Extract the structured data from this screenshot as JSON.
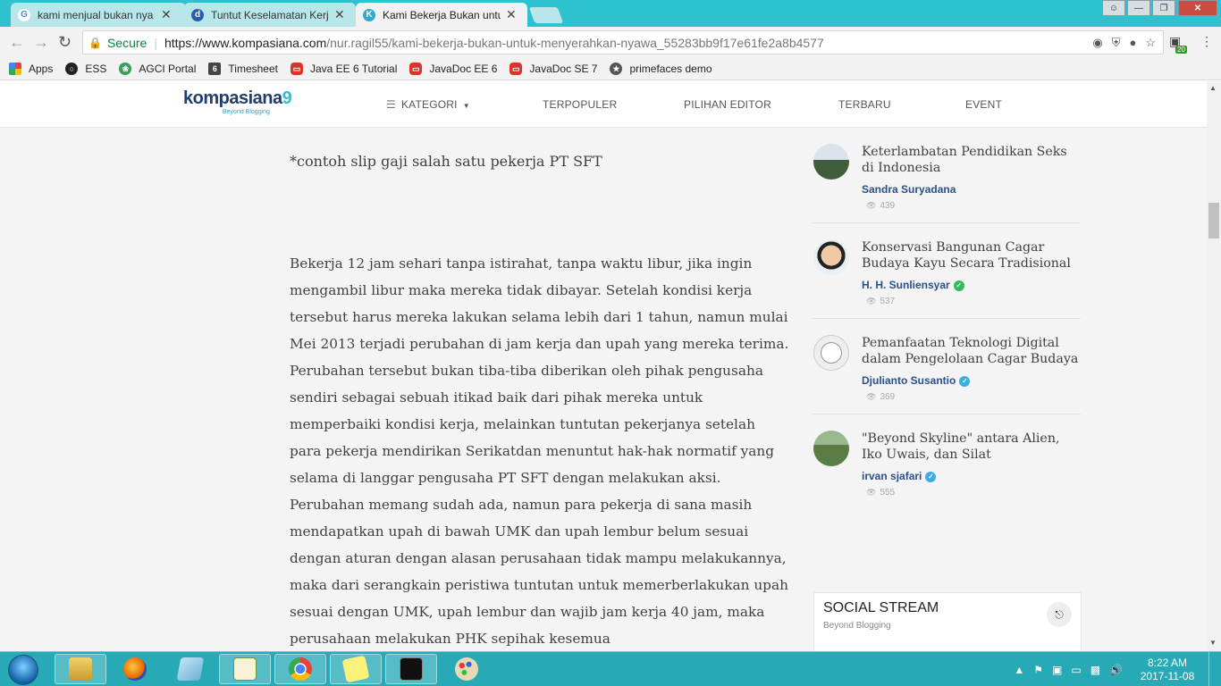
{
  "browser": {
    "tabs": [
      {
        "title": "kami menjual bukan nya",
        "icon": "google-icon",
        "active": false
      },
      {
        "title": "Tuntut Keselamatan Kerja",
        "icon": "site-d-icon",
        "active": false
      },
      {
        "title": "Kami Bekerja Bukan untu",
        "icon": "kompasiana-icon",
        "active": true
      }
    ],
    "close_glyph": "✕",
    "secure_label": "Secure",
    "url_host": "https://www.kompasiana.com",
    "url_path": "/nur.ragil55/kami-bekerja-bukan-untuk-menyerahkan-nyawa_55283bb9f17e61fe2a8b4577",
    "extension_badge": "20"
  },
  "bookmarks": [
    {
      "label": "Apps",
      "icon": "apps-grid-icon"
    },
    {
      "label": "ESS",
      "icon": "ess-icon"
    },
    {
      "label": "AGCI Portal",
      "icon": "agci-icon"
    },
    {
      "label": "Timesheet",
      "icon": "timesheet-icon"
    },
    {
      "label": "Java EE 6 Tutorial",
      "icon": "oracle-icon"
    },
    {
      "label": "JavaDoc EE 6",
      "icon": "oracle-icon"
    },
    {
      "label": "JavaDoc SE 7",
      "icon": "oracle-icon"
    },
    {
      "label": "primefaces demo",
      "icon": "primefaces-icon"
    }
  ],
  "site": {
    "logo_text": "kompasiana",
    "logo_nine": "9",
    "logo_tagline": "Beyond Blogging",
    "nav": {
      "kategori": "KATEGORI",
      "terpopuler": "TERPOPULER",
      "pilihan_editor": "PILIHAN EDITOR",
      "terbaru": "TERBARU",
      "event": "EVENT"
    }
  },
  "article": {
    "caption": "*contoh slip gaji salah satu pekerja PT SFT",
    "body": "Bekerja 12 jam sehari tanpa istirahat, tanpa waktu libur, jika ingin mengambil libur maka mereka tidak dibayar. Setelah kondisi kerja tersebut harus mereka lakukan selama lebih dari 1 tahun, namun mulai Mei 2013 terjadi perubahan di jam kerja dan upah yang mereka terima. Perubahan tersebut bukan tiba-tiba diberikan oleh pihak pengusaha sendiri sebagai sebuah itikad baik dari pihak mereka untuk memperbaiki kondisi kerja, melainkan tuntutan pekerjanya setelah para pekerja mendirikan Serikatdan menuntut hak-hak normatif yang selama di langgar pengusaha PT SFT dengan melakukan aksi. Perubahan memang sudah ada, namun para pekerja di sana masih mendapatkan upah di bawah UMK dan upah lembur belum sesuai dengan aturan dengan alasan perusahaan tidak mampu melakukannya, maka dari serangkain peristiwa tuntutan untuk memerberlakukan upah sesuai dengan UMK, upah lembur dan wajib jam kerja 40 jam, maka perusahaan melakukan PHK sepihak kesemua"
  },
  "sidebar": {
    "items": [
      {
        "title": "Keterlambatan Pendidikan Seks di Indonesia",
        "author": "Sandra Suryadana",
        "verified": false,
        "views": "439"
      },
      {
        "title": "Konservasi Bangunan Cagar Budaya Kayu Secara Tradisional",
        "author": "H. H. Sunliensyar",
        "verified": true,
        "verified_color": "#2ebd59",
        "views": "537"
      },
      {
        "title": "Pemanfaatan Teknologi Digital dalam Pengelolaan Cagar Budaya",
        "author": "Djulianto Susantio",
        "verified": true,
        "verified_color": "#3aaee0",
        "views": "369"
      },
      {
        "title": "\"Beyond Skyline\" antara Alien, Iko Uwais, dan Silat",
        "author": "irvan sjafari",
        "verified": true,
        "verified_color": "#3aaee0",
        "views": "555"
      }
    ],
    "social_title": "SOCIAL STREAM",
    "social_subtitle": "Beyond Blogging"
  },
  "taskbar": {
    "apps": [
      "windows-explorer-icon",
      "firefox-icon",
      "notepad-icon",
      "notepadpp-icon",
      "chrome-icon",
      "sticky-notes-icon",
      "cmd-icon",
      "paint-icon"
    ],
    "time": "8:22 AM",
    "date": "2017-11-08"
  },
  "colors": {
    "tab_strip": "#2ec1cf",
    "taskbar": "#27aab5",
    "link_author": "#2a4f8a",
    "secure_green": "#0b8043"
  }
}
